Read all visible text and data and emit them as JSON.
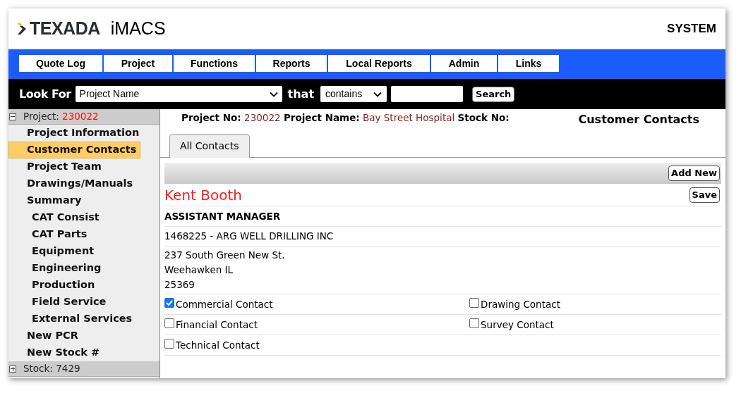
{
  "header": {
    "brand": "TEXADA",
    "product": "iMACS",
    "user": "SYSTEM"
  },
  "nav": [
    "Quote Log",
    "Project",
    "Functions",
    "Reports",
    "Local Reports",
    "Admin",
    "Links"
  ],
  "search": {
    "label": "Look For",
    "field": "Project Name",
    "connector": "that",
    "operator": "contains",
    "button": "Search"
  },
  "sidebar": {
    "groups": [
      {
        "label": "Project:",
        "value": "230022",
        "expanded": true,
        "items": [
          {
            "label": "Project Information",
            "selected": false
          },
          {
            "label": "Customer Contacts",
            "selected": true
          },
          {
            "label": "Project Team",
            "selected": false
          },
          {
            "label": "Drawings/Manuals",
            "selected": false
          },
          {
            "label": "Summary",
            "selected": false,
            "children": [
              {
                "label": "CAT Consist",
                "selected": false
              },
              {
                "label": "CAT Parts",
                "selected": false
              },
              {
                "label": "Equipment",
                "selected": false
              },
              {
                "label": "Engineering",
                "selected": false
              },
              {
                "label": "Production",
                "selected": false
              },
              {
                "label": "Field Service",
                "selected": false
              },
              {
                "label": "External Services",
                "selected": false
              }
            ]
          },
          {
            "label": "New PCR",
            "selected": false
          },
          {
            "label": "New Stock #",
            "selected": false
          }
        ]
      },
      {
        "label": "Stock:",
        "value": "7429",
        "expanded": false
      }
    ]
  },
  "info": [
    {
      "label": "Project No:",
      "value": "230022"
    },
    {
      "label": "Project Name:",
      "value": "Bay Street Hospital"
    },
    {
      "label": "Stock No:"
    }
  ],
  "page_title": "Customer Contacts",
  "tabs": [
    {
      "label": "All Contacts",
      "selected": true
    }
  ],
  "toolbar": {
    "button": "Add New"
  },
  "contact": {
    "name": "Kent Booth",
    "save": "Save",
    "title": "ASSISTANT MANAGER",
    "customer": "1468225 - ARG WELL DRILLING INC",
    "address": [
      "237 South Green New St.",
      "Weehawken IL",
      "25369"
    ],
    "roles": [
      {
        "label": "Commercial Contact",
        "checked": true
      },
      {
        "label": "Drawing Contact",
        "checked": false
      },
      {
        "label": "Financial Contact",
        "checked": false
      },
      {
        "label": "Survey Contact",
        "checked": false
      },
      {
        "label": "Technical Contact",
        "checked": false
      }
    ]
  }
}
